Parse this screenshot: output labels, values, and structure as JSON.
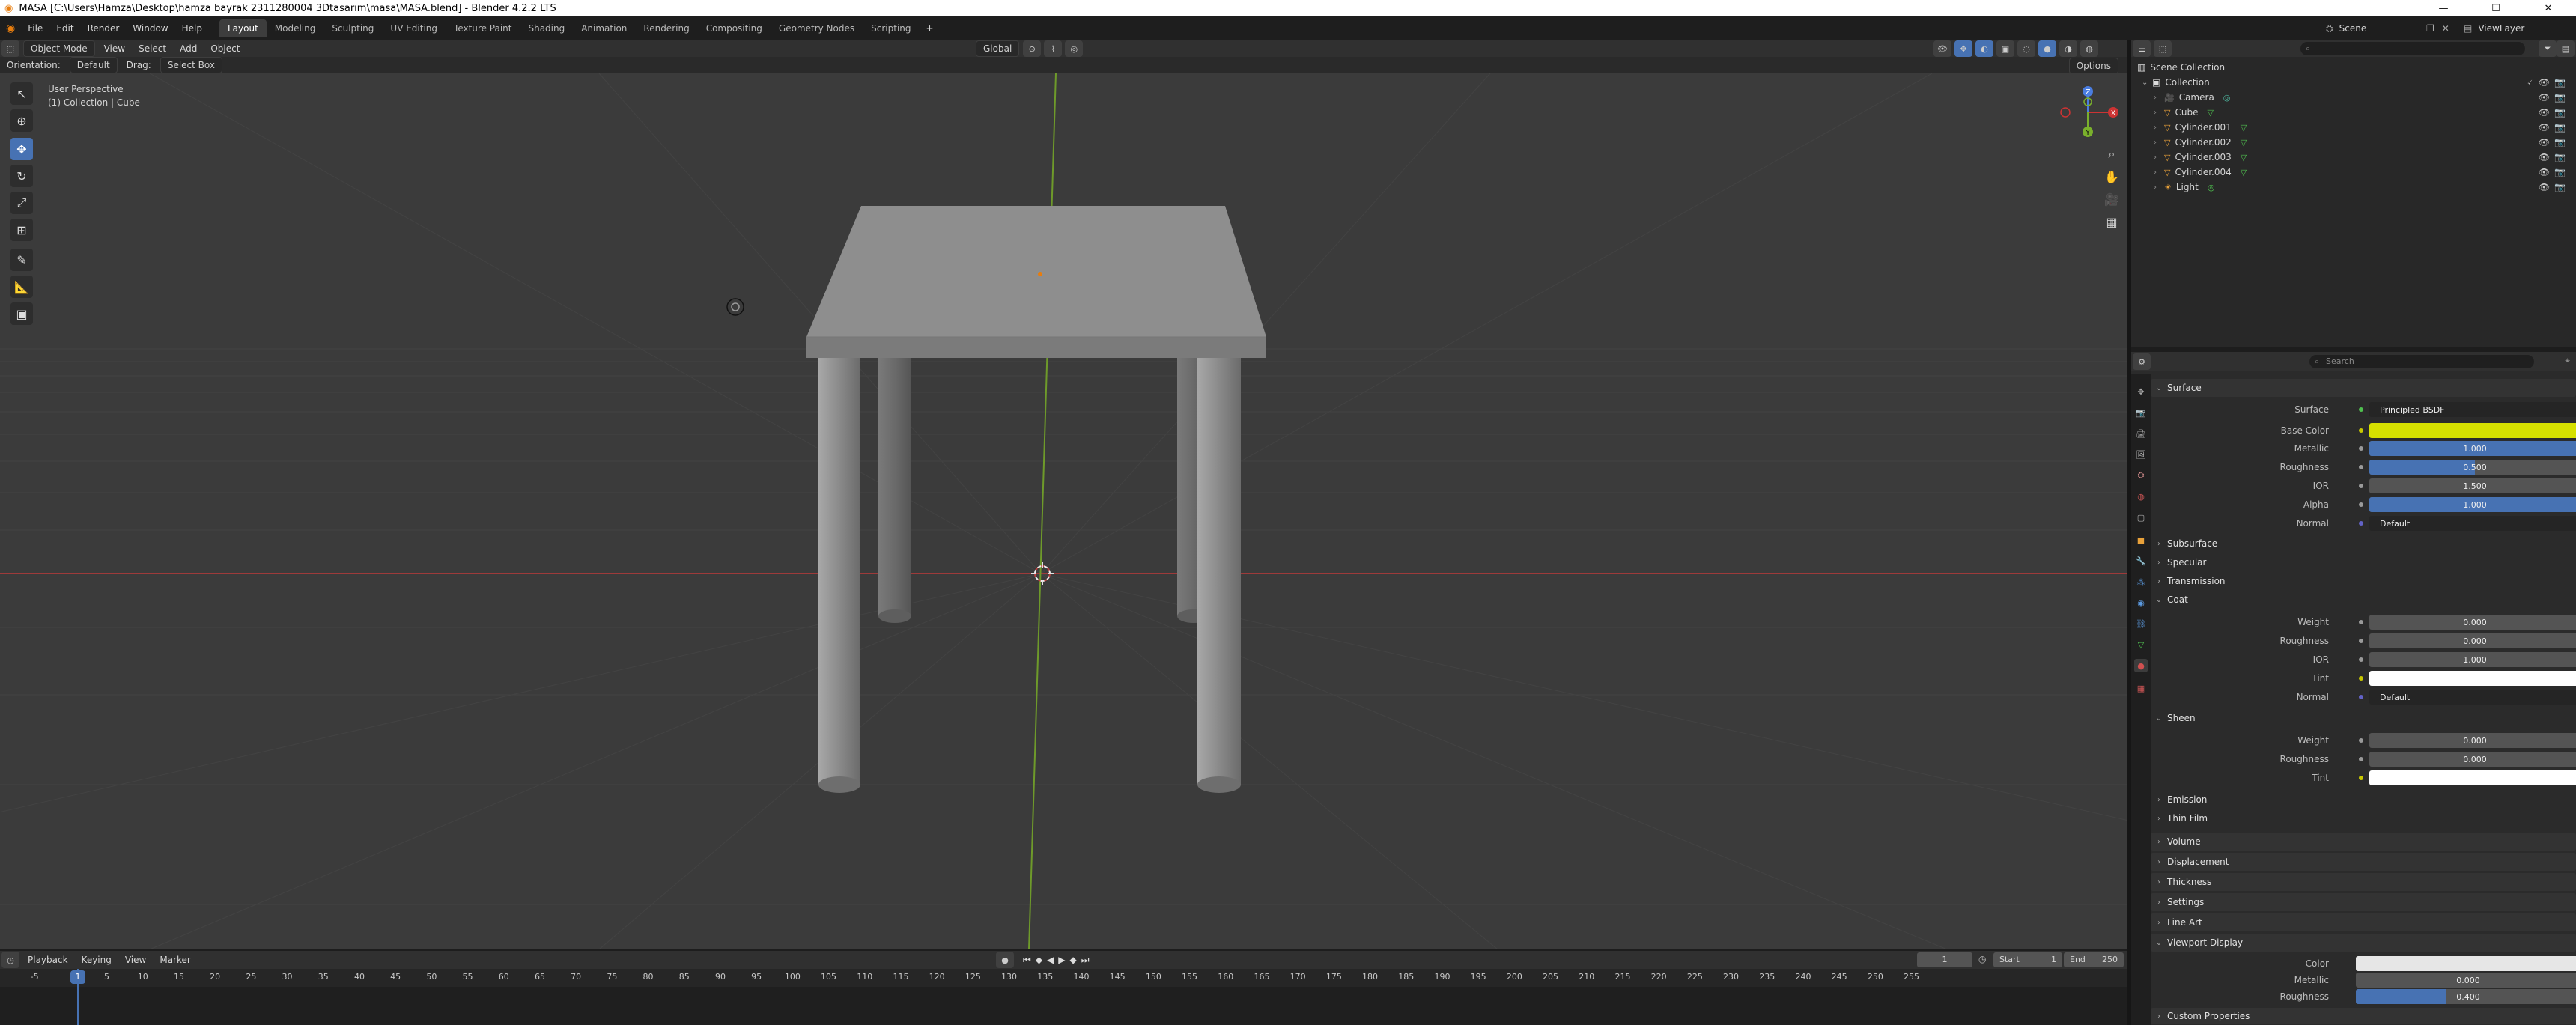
{
  "window": {
    "title": "MASA [C:\\Users\\Hamza\\Desktop\\hamza bayrak 2311280004   3Dtasarım\\masa\\MASA.blend] - Blender 4.2.2 LTS",
    "minimize": "—",
    "maximize": "☐",
    "close": "✕"
  },
  "menu": {
    "items": [
      "File",
      "Edit",
      "Render",
      "Window",
      "Help"
    ],
    "workspaces": [
      "Layout",
      "Modeling",
      "Sculpting",
      "UV Editing",
      "Texture Paint",
      "Shading",
      "Animation",
      "Rendering",
      "Compositing",
      "Geometry Nodes",
      "Scripting"
    ],
    "add_tab": "+",
    "scene": "Scene",
    "view_layer": "ViewLayer"
  },
  "viewport_header": {
    "mode": "Object Mode",
    "menus": [
      "View",
      "Select",
      "Add",
      "Object"
    ],
    "transform": "Global",
    "orientation_label": "Orientation:",
    "orientation_value": "Default",
    "drag_label": "Drag:",
    "drag_value": "Select Box",
    "options": "Options"
  },
  "viewport": {
    "perspective": "User Perspective",
    "context": "(1) Collection | Cube",
    "background": "#3b3b3b",
    "x_axis_color": "#9e3a3a",
    "y_axis_color": "#6e9a2a"
  },
  "gizmo": {
    "x": "X",
    "y": "Y",
    "z": "Z"
  },
  "outliner": {
    "search_placeholder": "",
    "scene_collection": "Scene Collection",
    "collection": "Collection",
    "objects": [
      {
        "name": "Camera",
        "icon": "camera-icon"
      },
      {
        "name": "Cube",
        "icon": "mesh-icon"
      },
      {
        "name": "Cylinder.001",
        "icon": "mesh-icon"
      },
      {
        "name": "Cylinder.002",
        "icon": "mesh-icon"
      },
      {
        "name": "Cylinder.003",
        "icon": "mesh-icon"
      },
      {
        "name": "Cylinder.004",
        "icon": "mesh-icon"
      },
      {
        "name": "Light",
        "icon": "light-icon"
      }
    ]
  },
  "properties": {
    "search_placeholder": "Search",
    "surface_section": "Surface",
    "surface_label": "Surface",
    "surface_value": "Principled BSDF",
    "base_color_label": "Base Color",
    "base_color": "#d6e000",
    "metallic_label": "Metallic",
    "metallic": "1.000",
    "metallic_fraction": 1.0,
    "roughness_label": "Roughness",
    "roughness": "0.500",
    "roughness_fraction": 0.5,
    "ior_label": "IOR",
    "ior": "1.500",
    "alpha_label": "Alpha",
    "alpha": "1.000",
    "alpha_fraction": 1.0,
    "normal_label": "Normal",
    "normal_value": "Default",
    "subsurface": "Subsurface",
    "specular": "Specular",
    "transmission": "Transmission",
    "coat": "Coat",
    "coat_weight_label": "Weight",
    "coat_weight": "0.000",
    "coat_roughness_label": "Roughness",
    "coat_roughness": "0.000",
    "coat_ior_label": "IOR",
    "coat_ior": "1.000",
    "coat_tint_label": "Tint",
    "coat_tint": "#ffffff",
    "coat_normal_label": "Normal",
    "coat_normal": "Default",
    "sheen": "Sheen",
    "sheen_weight_label": "Weight",
    "sheen_weight": "0.000",
    "sheen_roughness_label": "Roughness",
    "sheen_roughness": "0.000",
    "sheen_tint_label": "Tint",
    "sheen_tint": "#ffffff",
    "emission": "Emission",
    "thin_film": "Thin Film",
    "volume": "Volume",
    "displacement": "Displacement",
    "thickness": "Thickness",
    "settings": "Settings",
    "line_art": "Line Art",
    "viewport_display": "Viewport Display",
    "vd_color_label": "Color",
    "vd_color": "#e6e6e6",
    "vd_metallic_label": "Metallic",
    "vd_metallic": "0.000",
    "vd_roughness_label": "Roughness",
    "vd_roughness": "0.400",
    "vd_roughness_fraction": 0.4,
    "custom_properties": "Custom Properties"
  },
  "timeline": {
    "menus": [
      "Playback",
      "Keying",
      "View",
      "Marker"
    ],
    "current_frame": "1",
    "start_label": "Start",
    "start": "1",
    "end_label": "End",
    "end": "250",
    "ticks": [
      "-5",
      "1",
      "5",
      "10",
      "15",
      "20",
      "25",
      "30",
      "35",
      "40",
      "45",
      "50",
      "55",
      "60",
      "65",
      "70",
      "75",
      "80",
      "85",
      "90",
      "95",
      "100",
      "105",
      "110",
      "115",
      "120",
      "125",
      "130",
      "135",
      "140",
      "145",
      "150",
      "155",
      "160",
      "165",
      "170",
      "175",
      "180",
      "185",
      "190",
      "195",
      "200",
      "205",
      "210",
      "215",
      "220",
      "225",
      "230",
      "235",
      "240",
      "245",
      "250",
      "255"
    ]
  }
}
